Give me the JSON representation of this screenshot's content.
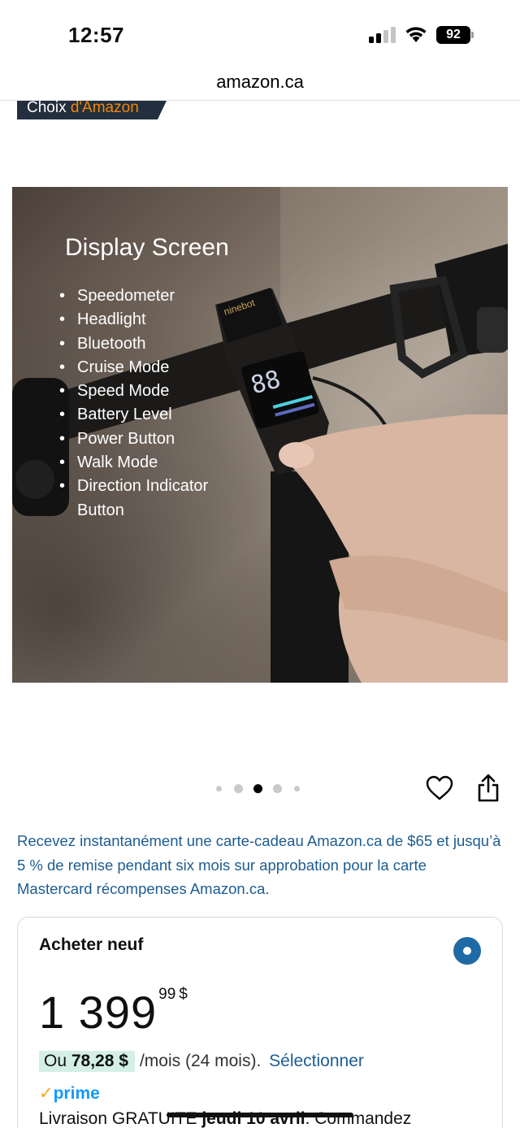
{
  "status_bar": {
    "time": "12:57",
    "battery_level": "92"
  },
  "browser": {
    "url": "amazon.ca"
  },
  "badge": {
    "label_part1": "Choix",
    "label_part2": "d'Amazon"
  },
  "product_image": {
    "title": "Display Screen",
    "features": [
      "Speedometer",
      "Headlight",
      "Bluetooth",
      "Cruise Mode",
      "Speed Mode",
      "Battery Level",
      "Power Button",
      "Walk Mode",
      "Direction Indicator Button"
    ],
    "brand_text": "ninebot",
    "display_digits": "88"
  },
  "carousel": {
    "total_images": 5,
    "active_index": 2
  },
  "promo": {
    "text": "Recevez instantanément une carte-cadeau Amazon.ca de $65 et jusqu’à 5 % de remise pendant six mois sur approbation pour la carte Mastercard récompenses Amazon.ca."
  },
  "buy_box": {
    "title": "Acheter neuf",
    "price_whole": "1 399",
    "price_cents": "99",
    "currency": "$",
    "monthly_prefix": "Ou",
    "monthly_amount": "78,28 $",
    "monthly_terms": "/mois (24 mois).",
    "monthly_link": "Sélectionner",
    "prime_label": "prime",
    "delivery_prefix": "Livraison GRATUITE",
    "delivery_date": "jeudi 10 avril",
    "delivery_suffix": ". Commandez"
  },
  "colors": {
    "link": "#1d5c91",
    "badge_bg": "#232f3e",
    "badge_accent": "#f08804",
    "prime": "#1399ff",
    "monthly_highlight": "#d4f0e6",
    "radio": "#1f6aa5"
  }
}
